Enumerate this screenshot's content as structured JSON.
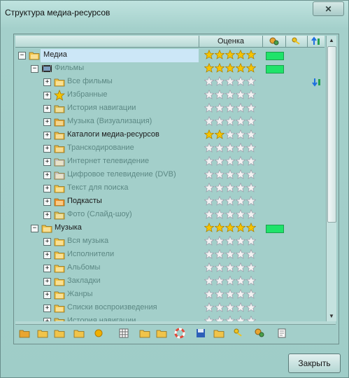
{
  "window": {
    "title": "Структура медиа-ресурсов",
    "close_glyph": "✕"
  },
  "table": {
    "columns": [
      "",
      "Оценка",
      "settings-icon",
      "key-icon",
      "sort-icon"
    ],
    "rows": [
      {
        "label": "Медиа",
        "level": 0,
        "expander": "−",
        "icon": "folder-open-icon",
        "rating": 5,
        "green": true,
        "dim": false,
        "selected": true
      },
      {
        "label": "Фильмы",
        "level": 1,
        "expander": "−",
        "icon": "film-icon",
        "rating": 5,
        "green": true,
        "dim": true
      },
      {
        "label": "Все фильмы",
        "level": 2,
        "expander": "+",
        "icon": "folder-open-icon",
        "rating": 0,
        "dim": true,
        "sort": true
      },
      {
        "label": "Избранные",
        "level": 2,
        "expander": "+",
        "icon": "star-icon",
        "rating": 0,
        "dim": true
      },
      {
        "label": "История навигации",
        "level": 2,
        "expander": "+",
        "icon": "history-icon",
        "rating": 0,
        "dim": true
      },
      {
        "label": "Музыка (Визуализация)",
        "level": 2,
        "expander": "+",
        "icon": "music-video-icon",
        "rating": 0,
        "dim": true
      },
      {
        "label": "Каталоги медиа-ресурсов",
        "level": 2,
        "expander": "+",
        "icon": "catalog-icon",
        "rating": 2,
        "dim": false
      },
      {
        "label": "Транскодирование",
        "level": 2,
        "expander": "+",
        "icon": "transcode-icon",
        "rating": 0,
        "dim": true
      },
      {
        "label": "Интернет телевидение",
        "level": 2,
        "expander": "+",
        "icon": "globe-tv-icon",
        "rating": 0,
        "dim": true
      },
      {
        "label": "Цифровое телевидение (DVB)",
        "level": 2,
        "expander": "+",
        "icon": "dvb-icon",
        "rating": 0,
        "dim": true
      },
      {
        "label": "Текст для поиска",
        "level": 2,
        "expander": "+",
        "icon": "text-search-icon",
        "rating": 0,
        "dim": true
      },
      {
        "label": "Подкасты",
        "level": 2,
        "expander": "+",
        "icon": "podcast-icon",
        "rating": 0,
        "dim": false
      },
      {
        "label": "Фото (Слайд-шоу)",
        "level": 2,
        "expander": "+",
        "icon": "photo-icon",
        "rating": 0,
        "dim": true
      },
      {
        "label": "Музыка",
        "level": 1,
        "expander": "−",
        "icon": "music-folder-icon",
        "rating": 5,
        "green": true,
        "dim": false
      },
      {
        "label": "Вся музыка",
        "level": 2,
        "expander": "+",
        "icon": "folder-open-icon",
        "rating": 0,
        "dim": true
      },
      {
        "label": "Исполнители",
        "level": 2,
        "expander": "+",
        "icon": "artists-icon",
        "rating": 0,
        "dim": true
      },
      {
        "label": "Альбомы",
        "level": 2,
        "expander": "+",
        "icon": "albums-icon",
        "rating": 0,
        "dim": true
      },
      {
        "label": "Закладки",
        "level": 2,
        "expander": "+",
        "icon": "bookmarks-icon",
        "rating": 0,
        "dim": true
      },
      {
        "label": "Жанры",
        "level": 2,
        "expander": "+",
        "icon": "genres-icon",
        "rating": 0,
        "dim": true
      },
      {
        "label": "Списки воспроизведения",
        "level": 2,
        "expander": "+",
        "icon": "playlist-icon",
        "rating": 0,
        "dim": true
      },
      {
        "label": "История навигации",
        "level": 2,
        "expander": "+",
        "icon": "history-icon",
        "rating": 0,
        "dim": true
      }
    ]
  },
  "toolbar": [
    "add-media-icon",
    "add-folder-icon",
    "edit-folder-icon",
    "open-icon",
    "sun-icon",
    "grid-icon",
    "export-icon",
    "import-icon",
    "help-icon",
    "save-icon",
    "folder-up-icon",
    "key-icon",
    "settings-icon",
    "notes-icon"
  ],
  "footer": {
    "close_label": "Закрыть"
  },
  "colors": {
    "star_full": "#f5c400",
    "star_empty": "#f2f2f2",
    "green": "#1fe36a"
  }
}
